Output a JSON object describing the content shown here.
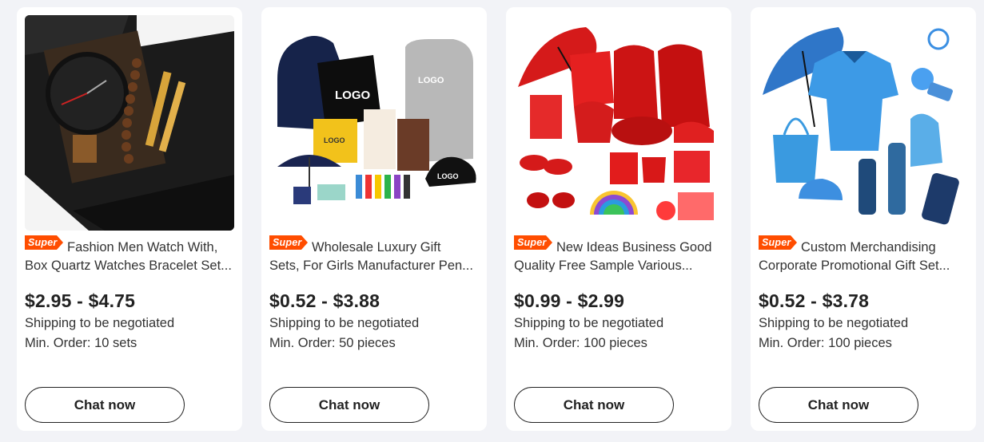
{
  "badge_label": "Super",
  "colors": {
    "badge": "#ff4d00",
    "text": "#222222",
    "card": "#ffffff",
    "page": "#f2f3f7"
  },
  "products": [
    {
      "image": "watch-gift-set-image",
      "title_line1": "Fashion Men Watch With,",
      "title_line2": "Box Quartz Watches Bracelet Set...",
      "price": "$2.95 - $4.75",
      "shipping": "Shipping to be negotiated",
      "min_order": "Min. Order: 10 sets",
      "cta": "Chat now"
    },
    {
      "image": "logo-merch-bundle-image",
      "title_line1": "Wholesale Luxury Gift",
      "title_line2": "Sets, For Girls Manufacturer Pen...",
      "price": "$0.52 - $3.88",
      "shipping": "Shipping to be negotiated",
      "min_order": "Min. Order: 50 pieces",
      "cta": "Chat now"
    },
    {
      "image": "red-promo-items-image",
      "title_line1": "New Ideas Business Good",
      "title_line2": "Quality Free Sample Various...",
      "price": "$0.99 - $2.99",
      "shipping": "Shipping to be negotiated",
      "min_order": "Min. Order: 100 pieces",
      "cta": "Chat now"
    },
    {
      "image": "blue-promo-items-image",
      "title_line1": "Custom Merchandising",
      "title_line2": "Corporate Promotional Gift Set...",
      "price": "$0.52 - $3.78",
      "shipping": "Shipping to be negotiated",
      "min_order": "Min. Order: 100 pieces",
      "cta": "Chat now"
    }
  ],
  "image_text": {
    "logo": "LOGO"
  }
}
